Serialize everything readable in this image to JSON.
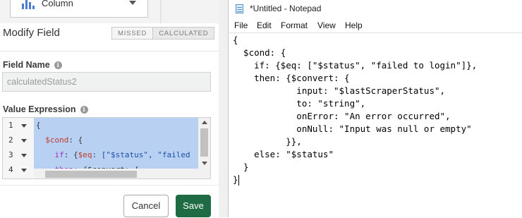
{
  "chart_type": {
    "label": "Column"
  },
  "modify_field": {
    "title": "Modify Field",
    "toggle": [
      "MISSED",
      "CALCULATED"
    ],
    "field_name_label": "Field Name",
    "field_name_value": "calculatedStatus2",
    "value_expression_label": "Value Expression",
    "line_numbers": [
      "1",
      "2",
      "3",
      "4"
    ],
    "code": {
      "l1": "{",
      "l2_key": "$cond",
      "l2_rest": ": {",
      "l3_key": "if",
      "l3_mid": ": {",
      "l3_op": "$eq",
      "l3_rest": ": [\"$status\", \"failed",
      "l4_key": "then",
      "l4_rest": ": {$convert: {"
    },
    "cancel_label": "Cancel",
    "save_label": "Save"
  },
  "notepad": {
    "title": "*Untitled - Notepad",
    "menu": [
      "File",
      "Edit",
      "Format",
      "View",
      "Help"
    ],
    "lines": [
      "{",
      "  $cond: {",
      "    if: {$eq: [\"$status\", \"failed to login\"]},",
      "    then: {$convert: {",
      "            input: \"$lastScraperStatus\",",
      "            to: \"string\",",
      "            onError: \"An error occurred\",",
      "            onNull: \"Input was null or empty\"",
      "          }},",
      "    else: \"$status\"",
      "  }",
      "}"
    ]
  },
  "colors": {
    "save_button": "#1f6b43",
    "selection": "#b8d1f3"
  }
}
